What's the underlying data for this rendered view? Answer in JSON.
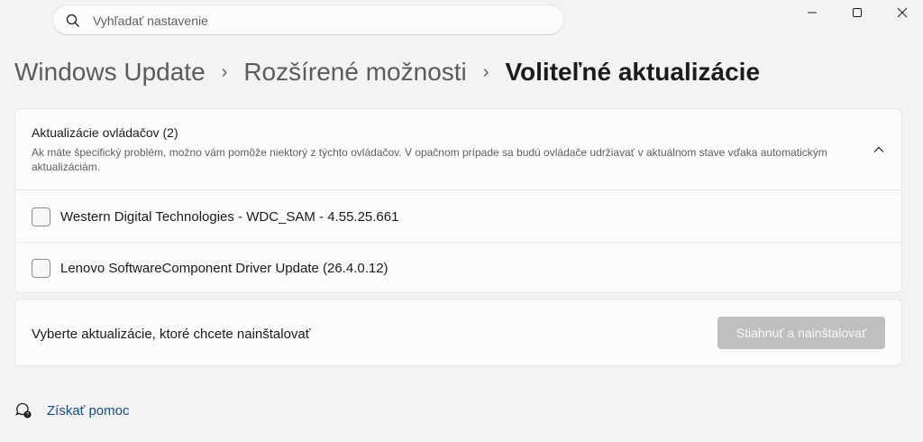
{
  "search": {
    "placeholder": "Vyhľadať nastavenie",
    "icon": "search-icon"
  },
  "window_controls": [
    "minimize-icon",
    "maximize-icon",
    "close-icon"
  ],
  "breadcrumb": {
    "items": [
      "Windows Update",
      "Rozšírené možnosti",
      "Voliteľné aktualizácie"
    ],
    "separator": "›"
  },
  "drivers": {
    "title": "Aktualizácie ovládačov (2)",
    "description": "Ak máte špecifický problém, možno vám pomôže niektorý z týchto ovládačov. V opačnom prípade sa budú ovládače udržiavať v aktuálnom stave vďaka automatickým aktualizáciám.",
    "expanded": true,
    "items": [
      {
        "label": "Western Digital Technologies - WDC_SAM - 4.55.25.661",
        "checked": false
      },
      {
        "label": "Lenovo SoftwareComponent Driver Update (26.4.0.12)",
        "checked": false
      }
    ]
  },
  "install": {
    "prompt": "Vyberte aktualizácie, ktoré chcete nainštalovať",
    "button_label": "Stiahnuť a nainštalovať",
    "button_enabled": false
  },
  "help": {
    "label": "Získať pomoc",
    "icon": "help-chat-icon"
  },
  "colors": {
    "background": "#f3f3f3",
    "card": "#fbfbfb",
    "link": "#134a8a",
    "disabled_button": "#bfbfbf"
  }
}
